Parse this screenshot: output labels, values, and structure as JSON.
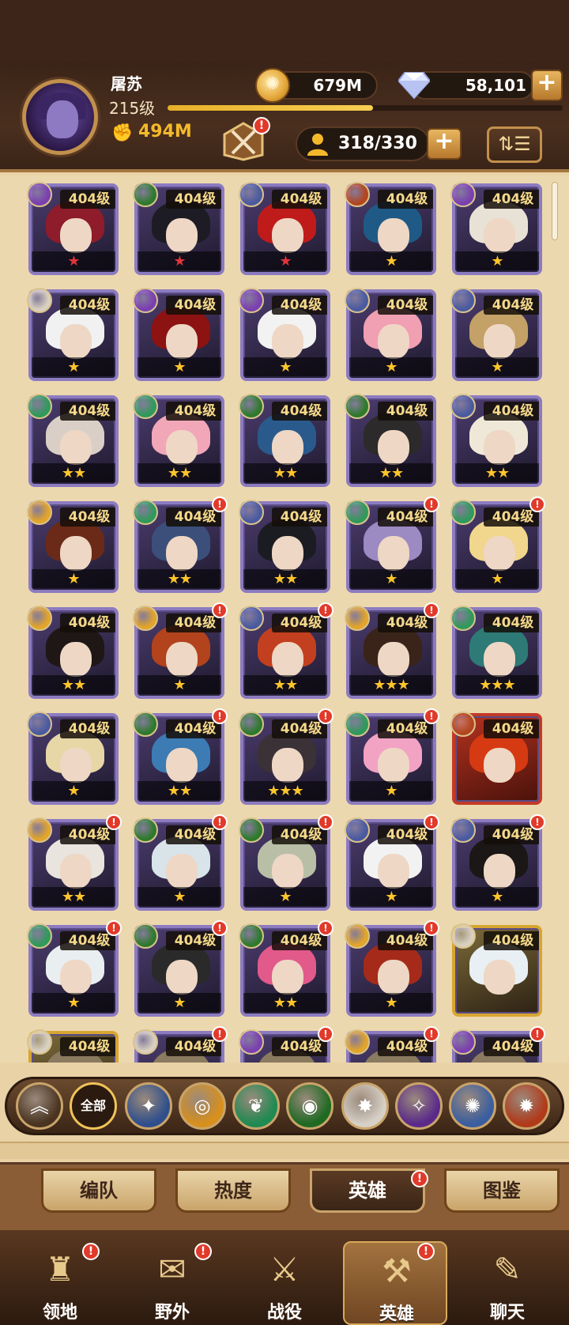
{
  "player": {
    "name": "屠苏",
    "level": "215级",
    "power": "494M",
    "exp_fraction": 0.52
  },
  "resources": {
    "gold": "679M",
    "diamonds": "58,101"
  },
  "hero_count": "318/330",
  "badge_mark": "!",
  "colors": {
    "accent_gold": "#f4b92b",
    "frame_purple": "#8c7bc0",
    "notification_red": "#e13a2a",
    "panel_brown": "#3d2619"
  },
  "heroes": [
    {
      "level": "404级",
      "stars": "★",
      "stars_color": "red",
      "faction": "#7a3fb0",
      "hair": "#8e1c2a",
      "badge": false
    },
    {
      "level": "404级",
      "stars": "★",
      "stars_color": "red",
      "faction": "#2e7a2c",
      "hair": "#1d1c25",
      "badge": false
    },
    {
      "level": "404级",
      "stars": "★",
      "stars_color": "red",
      "faction": "#4a5aa0",
      "hair": "#c01b1b",
      "badge": false
    },
    {
      "level": "404级",
      "stars": "★",
      "stars_color": "gold",
      "faction": "#b3451f",
      "hair": "#1f5a86",
      "badge": false
    },
    {
      "level": "404级",
      "stars": "★",
      "stars_color": "gold",
      "faction": "#7a3fb0",
      "hair": "#e8e2d6",
      "badge": false
    },
    {
      "level": "404级",
      "stars": "★",
      "stars_color": "gold",
      "faction": "#d9d0c0",
      "hair": "#f1f1f1",
      "badge": false
    },
    {
      "level": "404级",
      "stars": "★",
      "stars_color": "gold",
      "faction": "#7a3fb0",
      "hair": "#8d1212",
      "badge": false
    },
    {
      "level": "404级",
      "stars": "★",
      "stars_color": "gold",
      "faction": "#7a3fb0",
      "hair": "#f2f2f2",
      "badge": false
    },
    {
      "level": "404级",
      "stars": "★",
      "stars_color": "gold",
      "faction": "#4a5aa0",
      "hair": "#f19fb3",
      "badge": false
    },
    {
      "level": "404级",
      "stars": "★",
      "stars_color": "gold",
      "faction": "#4a5aa0",
      "hair": "#c3a167",
      "badge": false
    },
    {
      "level": "404级",
      "stars": "★★",
      "stars_color": "gold",
      "faction": "#2f9a5a",
      "hair": "#d9cfc6",
      "badge": false
    },
    {
      "level": "404级",
      "stars": "★★",
      "stars_color": "gold",
      "faction": "#2f9a5a",
      "hair": "#f1a7b8",
      "badge": false
    },
    {
      "level": "404级",
      "stars": "★★",
      "stars_color": "gold",
      "faction": "#2e7a2c",
      "hair": "#2a5a8c",
      "badge": false
    },
    {
      "level": "404级",
      "stars": "★★",
      "stars_color": "gold",
      "faction": "#2e7a2c",
      "hair": "#2c2a2a",
      "badge": false
    },
    {
      "level": "404级",
      "stars": "★★",
      "stars_color": "gold",
      "faction": "#4a5aa0",
      "hair": "#efe8d8",
      "badge": false
    },
    {
      "level": "404级",
      "stars": "★",
      "stars_color": "gold",
      "faction": "#e3a52a",
      "hair": "#6b2a18",
      "badge": false
    },
    {
      "level": "404级",
      "stars": "★★",
      "stars_color": "gold",
      "faction": "#2f9a5a",
      "hair": "#3b4f7a",
      "badge": true
    },
    {
      "level": "404级",
      "stars": "★★",
      "stars_color": "gold",
      "faction": "#4a5aa0",
      "hair": "#1b1c22",
      "badge": false
    },
    {
      "level": "404级",
      "stars": "★",
      "stars_color": "gold",
      "faction": "#2f9a5a",
      "hair": "#9c8ac3",
      "badge": true
    },
    {
      "level": "404级",
      "stars": "★",
      "stars_color": "gold",
      "faction": "#2f9a5a",
      "hair": "#f1d68d",
      "badge": true
    },
    {
      "level": "404级",
      "stars": "★★",
      "stars_color": "gold",
      "faction": "#e3a52a",
      "hair": "#1f1716",
      "badge": false
    },
    {
      "level": "404级",
      "stars": "★",
      "stars_color": "gold",
      "faction": "#e3a52a",
      "hair": "#b2431c",
      "badge": true
    },
    {
      "level": "404级",
      "stars": "★★",
      "stars_color": "gold",
      "faction": "#4a5aa0",
      "hair": "#c2401f",
      "badge": true
    },
    {
      "level": "404级",
      "stars": "★★★",
      "stars_color": "gold",
      "faction": "#e3a52a",
      "hair": "#3a241a",
      "badge": true
    },
    {
      "level": "404级",
      "stars": "★★★",
      "stars_color": "gold",
      "faction": "#2f9a5a",
      "hair": "#2d7a76",
      "badge": false
    },
    {
      "level": "404级",
      "stars": "★",
      "stars_color": "gold",
      "faction": "#4a5aa0",
      "hair": "#e7d6a6",
      "badge": false
    },
    {
      "level": "404级",
      "stars": "★★",
      "stars_color": "gold",
      "faction": "#2e7a2c",
      "hair": "#3c7bb3",
      "badge": true
    },
    {
      "level": "404级",
      "stars": "★★★",
      "stars_color": "gold",
      "faction": "#2e7a2c",
      "hair": "#3a3236",
      "badge": true
    },
    {
      "level": "404级",
      "stars": "★",
      "stars_color": "gold",
      "faction": "#2f9a5a",
      "hair": "#f2a3c4",
      "badge": true
    },
    {
      "level": "404级",
      "stars": "",
      "stars_color": "gold",
      "faction": "#b3451f",
      "hair": "#d63a12",
      "badge": false,
      "frame": "red"
    },
    {
      "level": "404级",
      "stars": "★★",
      "stars_color": "gold",
      "faction": "#e3a52a",
      "hair": "#e9e4de",
      "badge": true
    },
    {
      "level": "404级",
      "stars": "★",
      "stars_color": "gold",
      "faction": "#2e7a2c",
      "hair": "#d8e4ea",
      "badge": true
    },
    {
      "level": "404级",
      "stars": "★",
      "stars_color": "gold",
      "faction": "#2e7a2c",
      "hair": "#b8bfa6",
      "badge": true
    },
    {
      "level": "404级",
      "stars": "★",
      "stars_color": "gold",
      "faction": "#4a5aa0",
      "hair": "#f2f2f2",
      "badge": true
    },
    {
      "level": "404级",
      "stars": "★",
      "stars_color": "gold",
      "faction": "#4a5aa0",
      "hair": "#1a1716",
      "badge": true
    },
    {
      "level": "404级",
      "stars": "★",
      "stars_color": "gold",
      "faction": "#2f9a5a",
      "hair": "#e9eef0",
      "badge": true
    },
    {
      "level": "404级",
      "stars": "★",
      "stars_color": "gold",
      "faction": "#2e7a2c",
      "hair": "#2a2a2a",
      "badge": true
    },
    {
      "level": "404级",
      "stars": "★★",
      "stars_color": "gold",
      "faction": "#2e7a2c",
      "hair": "#e15a8a",
      "badge": true
    },
    {
      "level": "404级",
      "stars": "★",
      "stars_color": "gold",
      "faction": "#e3a52a",
      "hair": "#a52a1a",
      "badge": true
    },
    {
      "level": "404级",
      "stars": "",
      "stars_color": "gold",
      "faction": "#d9d0c0",
      "hair": "#e9f0f3",
      "badge": false,
      "frame": "gold"
    },
    {
      "level": "404级",
      "stars": "",
      "stars_color": "gold",
      "faction": "#d9d0c0",
      "hair": "#8a7a60",
      "badge": false,
      "frame": "gold"
    },
    {
      "level": "404级",
      "stars": "",
      "stars_color": "gold",
      "faction": "#d9d0c0",
      "hair": "#8a7a60",
      "badge": true
    },
    {
      "level": "404级",
      "stars": "",
      "stars_color": "gold",
      "faction": "#7a3fb0",
      "hair": "#8a7a60",
      "badge": true
    },
    {
      "level": "404级",
      "stars": "",
      "stars_color": "gold",
      "faction": "#e3a52a",
      "hair": "#8a7a60",
      "badge": true
    },
    {
      "level": "404级",
      "stars": "",
      "stars_color": "gold",
      "faction": "#7a3fb0",
      "hair": "#8a7a60",
      "badge": true
    }
  ],
  "filters": [
    {
      "icon": "chevron-up-icon",
      "color": "#4a3420",
      "glyph": "︽"
    },
    {
      "icon": "all-filter",
      "color": "#2b1a0f",
      "label": "全部"
    },
    {
      "icon": "star-faction-icon",
      "color": "#2f4f8c",
      "glyph": "✦"
    },
    {
      "icon": "sun-faction-icon",
      "color": "#d8901c",
      "glyph": "◎"
    },
    {
      "icon": "leaf-faction-icon",
      "color": "#1f8a52",
      "glyph": "❦"
    },
    {
      "icon": "eye-faction-icon",
      "color": "#1e6a22",
      "glyph": "◉"
    },
    {
      "icon": "light-faction-icon",
      "color": "#d7d0c6",
      "glyph": "✸"
    },
    {
      "icon": "void-faction-icon",
      "color": "#5a2a8a",
      "glyph": "✧"
    },
    {
      "icon": "celestial-faction-icon",
      "color": "#3a5ea0",
      "glyph": "✺"
    },
    {
      "icon": "flame-faction-icon",
      "color": "#b13a1a",
      "glyph": "✹"
    }
  ],
  "subtabs": [
    {
      "label": "编队",
      "active": false
    },
    {
      "label": "热度",
      "active": false
    },
    {
      "label": "英雄",
      "active": true,
      "badge": true
    },
    {
      "label": "图鉴",
      "active": false
    }
  ],
  "bottom_nav": [
    {
      "label": "领地",
      "icon": "castle-icon",
      "glyph": "♜",
      "badge": true,
      "active": false
    },
    {
      "label": "野外",
      "icon": "map-scroll-icon",
      "glyph": "✉",
      "badge": true,
      "active": false
    },
    {
      "label": "战役",
      "icon": "sword-icon",
      "glyph": "⚔",
      "badge": false,
      "active": false
    },
    {
      "label": "英雄",
      "icon": "hero-helmet-icon",
      "glyph": "⚒",
      "badge": true,
      "active": true
    },
    {
      "label": "聊天",
      "icon": "chat-bubble-icon",
      "glyph": "✎",
      "badge": false,
      "active": false
    }
  ]
}
